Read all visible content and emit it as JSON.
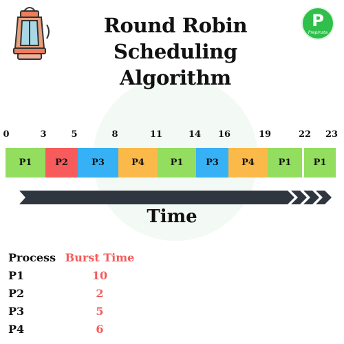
{
  "header": {
    "title_line1": "Round Robin Scheduling",
    "title_line2": "Algorithm",
    "logo_letter": "P",
    "logo_text": "PrepInsta"
  },
  "gantt": {
    "ticks": [
      "0",
      "3",
      "5",
      "8",
      "11",
      "14",
      "16",
      "19",
      "22",
      "23"
    ],
    "blocks": [
      {
        "label": "P1",
        "color": "#93dd5f"
      },
      {
        "label": "P2",
        "color": "#f75b5b"
      },
      {
        "label": "P3",
        "color": "#36b1f5"
      },
      {
        "label": "P4",
        "color": "#fbb949"
      },
      {
        "label": "P1",
        "color": "#93dd5f"
      },
      {
        "label": "P3",
        "color": "#36b1f5"
      },
      {
        "label": "P4",
        "color": "#fbb949"
      },
      {
        "label": "P1",
        "color": "#93dd5f"
      },
      {
        "label": "P1",
        "color": "#93dd5f"
      }
    ]
  },
  "axis_label": "Time",
  "table": {
    "header": {
      "process": "Process",
      "burst": "Burst Time"
    },
    "rows": [
      {
        "process": "P1",
        "burst": "10"
      },
      {
        "process": "P2",
        "burst": "2"
      },
      {
        "process": "P3",
        "burst": "5"
      },
      {
        "process": "P4",
        "burst": "6"
      }
    ]
  },
  "colors": {
    "burst_header": "#f55b5b",
    "arrow": "#2f3640"
  }
}
